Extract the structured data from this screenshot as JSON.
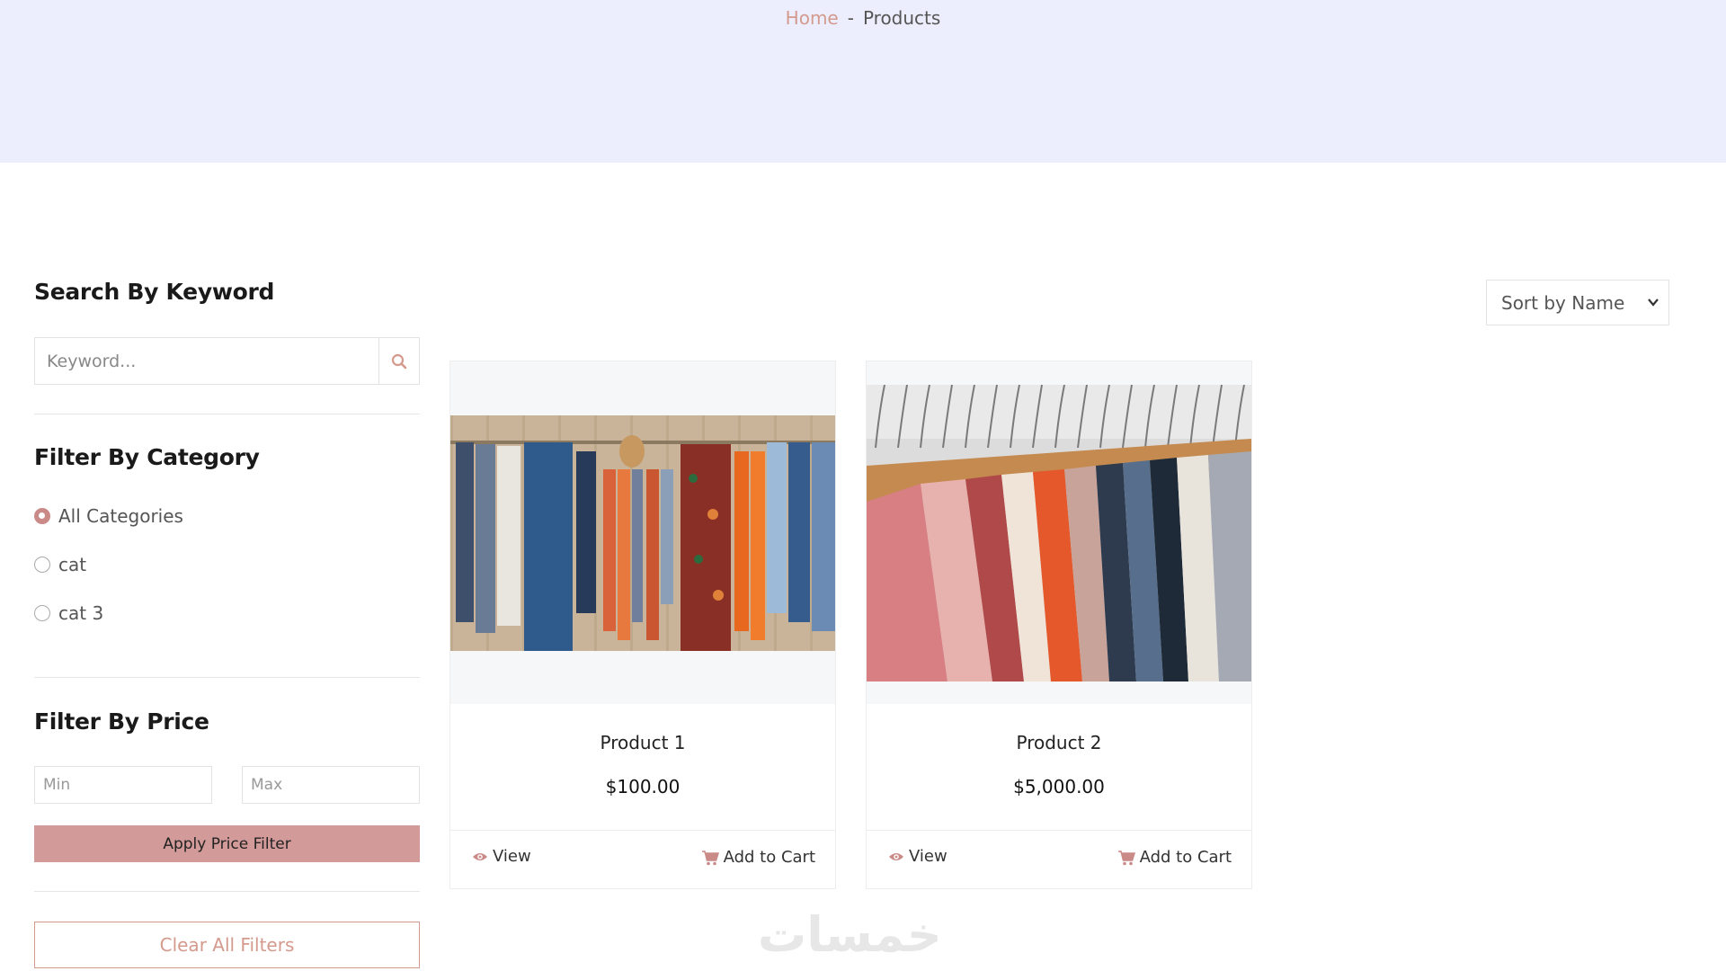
{
  "breadcrumb": {
    "home": "Home",
    "separator": "-",
    "current": "Products"
  },
  "sidebar": {
    "search": {
      "title": "Search By Keyword",
      "placeholder": "Keyword..."
    },
    "category": {
      "title": "Filter By Category",
      "options": [
        {
          "label": "All Categories",
          "checked": true
        },
        {
          "label": "cat",
          "checked": false
        },
        {
          "label": "cat 3",
          "checked": false
        }
      ]
    },
    "price": {
      "title": "Filter By Price",
      "min_placeholder": "Min",
      "max_placeholder": "Max",
      "apply_label": "Apply Price Filter"
    },
    "clear_label": "Clear All Filters"
  },
  "sort": {
    "selected": "Sort by Name"
  },
  "products": [
    {
      "name": "Product 1",
      "price": "$100.00",
      "view_label": "View",
      "cart_label": "Add to Cart"
    },
    {
      "name": "Product 2",
      "price": "$5,000.00",
      "view_label": "View",
      "cart_label": "Add to Cart"
    }
  ],
  "watermark": "خمسات",
  "colors": {
    "accent": "#d49a8d",
    "apply_button": "#d29a98",
    "banner": "#eceefe"
  }
}
